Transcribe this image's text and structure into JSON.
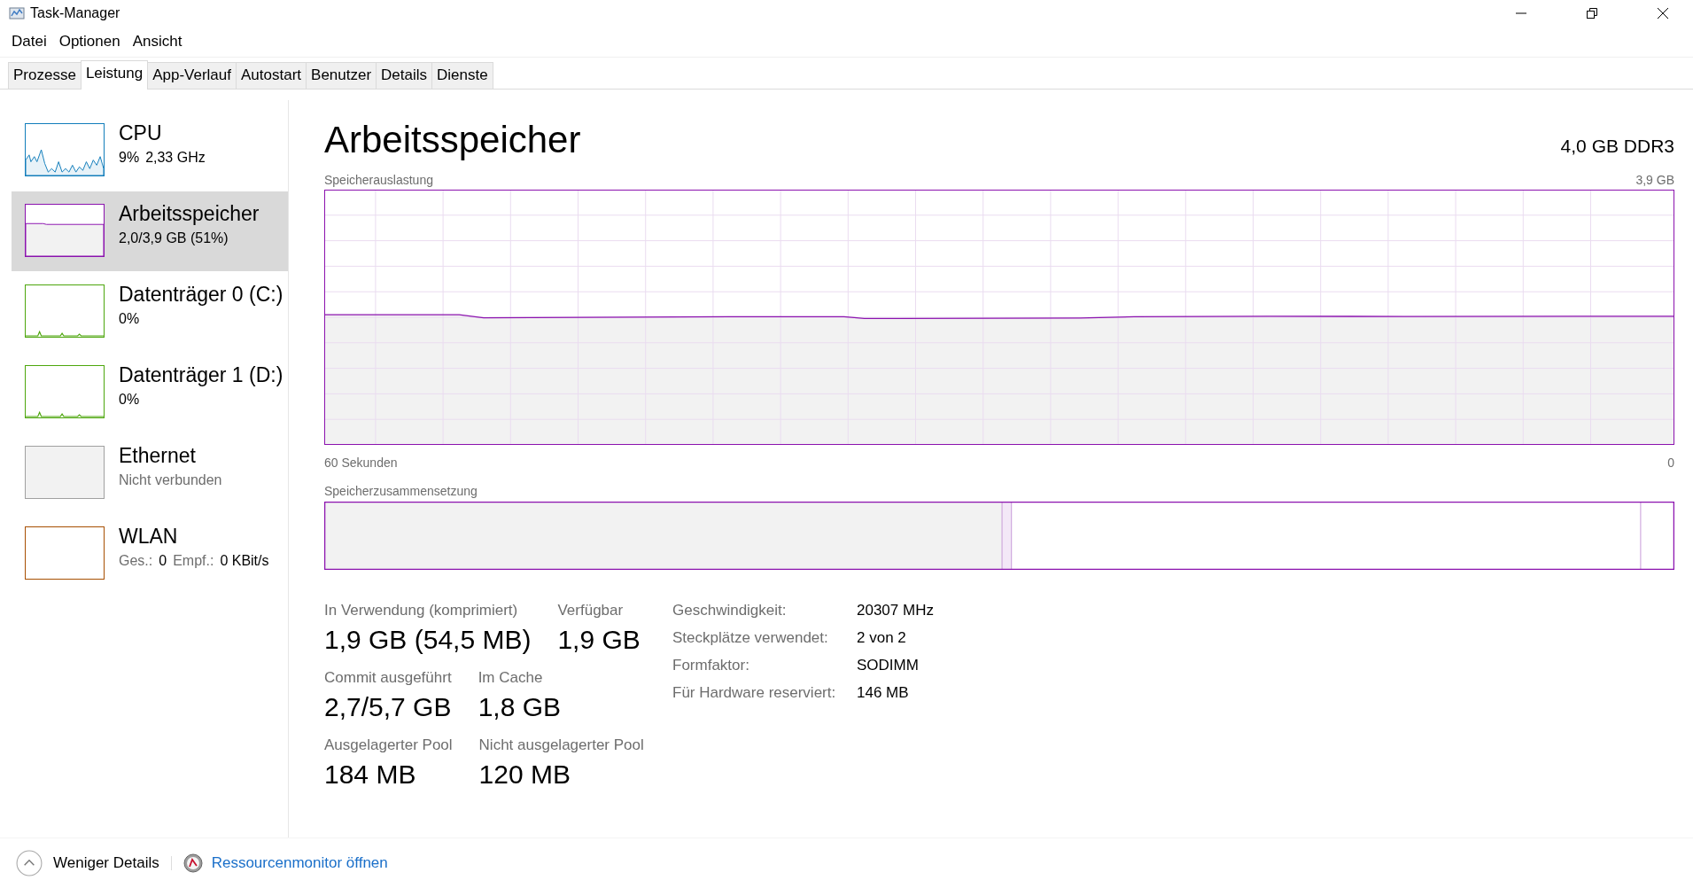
{
  "window": {
    "title": "Task-Manager"
  },
  "menu": [
    "Datei",
    "Optionen",
    "Ansicht"
  ],
  "tabs": [
    {
      "label": "Prozesse",
      "selected": false
    },
    {
      "label": "Leistung",
      "selected": true
    },
    {
      "label": "App-Verlauf",
      "selected": false
    },
    {
      "label": "Autostart",
      "selected": false
    },
    {
      "label": "Benutzer",
      "selected": false
    },
    {
      "label": "Details",
      "selected": false
    },
    {
      "label": "Dienste",
      "selected": false
    }
  ],
  "sidebar": {
    "items": [
      {
        "kind": "cpu",
        "name": "CPU",
        "color": "#117dbb",
        "selected": false,
        "detail": [
          {
            "text": "9%",
            "kind": "value"
          },
          {
            "text": "2,33 GHz",
            "kind": "value"
          }
        ]
      },
      {
        "kind": "memory",
        "name": "Arbeitsspeicher",
        "color": "#8b12ae",
        "selected": true,
        "detail": [
          {
            "text": "2,0/3,9 GB (51%)",
            "kind": "value"
          }
        ]
      },
      {
        "kind": "disk",
        "name": "Datenträger 0 (C:)",
        "color": "#4da60c",
        "selected": false,
        "detail": [
          {
            "text": "0%",
            "kind": "value"
          }
        ]
      },
      {
        "kind": "disk",
        "name": "Datenträger 1 (D:)",
        "color": "#4da60c",
        "selected": false,
        "detail": [
          {
            "text": "0%",
            "kind": "value"
          }
        ]
      },
      {
        "kind": "network",
        "name": "Ethernet",
        "color": "#a0a0a0",
        "selected": false,
        "detail": [
          {
            "text": "Nicht verbunden",
            "kind": "label"
          }
        ]
      },
      {
        "kind": "network",
        "name": "WLAN",
        "color": "#a74f01",
        "selected": false,
        "detail": [
          {
            "text": "Ges.:",
            "kind": "label"
          },
          {
            "text": "0",
            "kind": "value"
          },
          {
            "text": "Empf.:",
            "kind": "label"
          },
          {
            "text": "0 KBit/s",
            "kind": "value"
          }
        ]
      }
    ]
  },
  "main": {
    "title": "Arbeitsspeicher",
    "spec": "4,0 GB DDR3",
    "usage_graph": {
      "label": "Speicherauslastung",
      "max": "3,9 GB",
      "time_span": "60 Sekunden",
      "time_end": "0"
    },
    "composition": {
      "label": "Speicherzusammensetzung"
    },
    "stats": [
      {
        "label": "In Verwendung (komprimiert)",
        "value": "1,9 GB (54,5 MB)"
      },
      {
        "label": "Verfügbar",
        "value": "1,9 GB"
      },
      {
        "label": "Commit ausgeführt",
        "value": "2,7/5,7 GB"
      },
      {
        "label": "Im Cache",
        "value": "1,8 GB"
      },
      {
        "label": "Ausgelagerter Pool",
        "value": "184 MB"
      },
      {
        "label": "Nicht ausgelagerter Pool",
        "value": "120 MB"
      }
    ],
    "details": [
      {
        "label": "Geschwindigkeit:",
        "value": "20307 MHz"
      },
      {
        "label": "Steckplätze verwendet:",
        "value": "2 von 2"
      },
      {
        "label": "Formfaktor:",
        "value": "SODIMM"
      },
      {
        "label": "Für Hardware reserviert:",
        "value": "146 MB"
      }
    ]
  },
  "footer": {
    "toggle": "Weniger Details",
    "link": "Ressourcenmonitor öffnen"
  }
}
